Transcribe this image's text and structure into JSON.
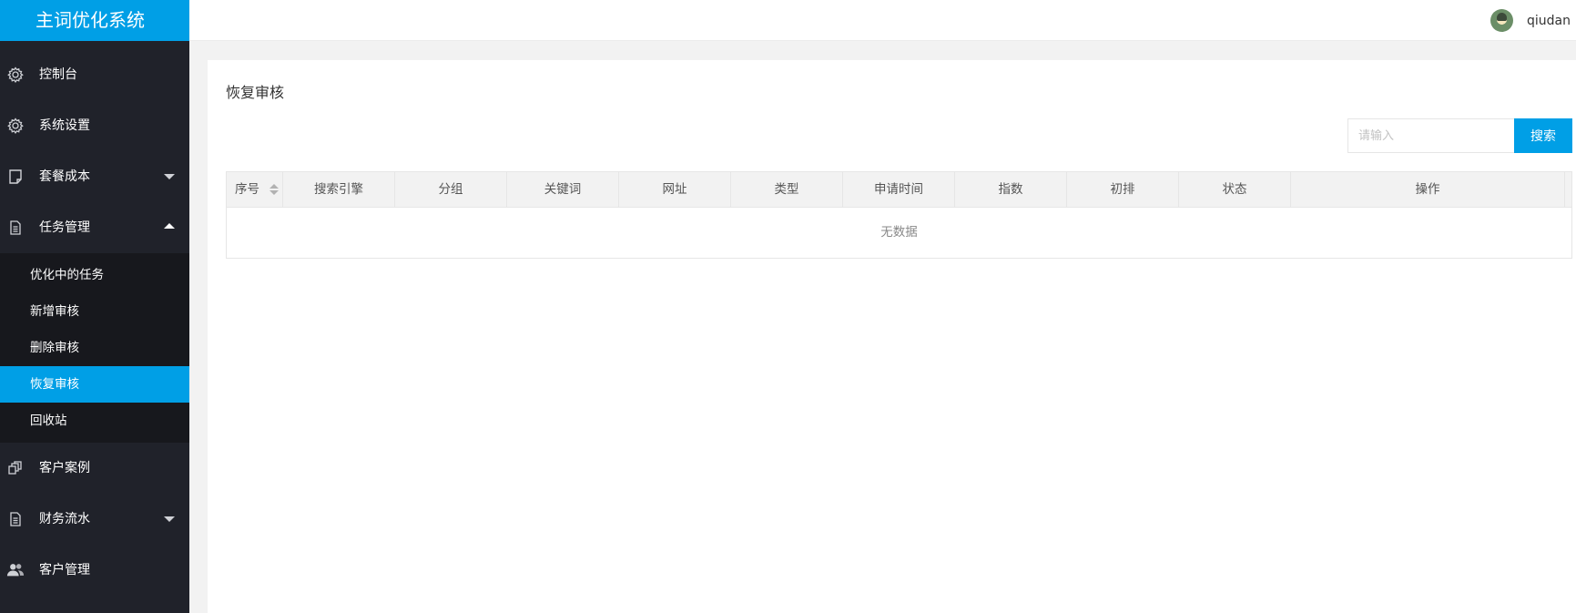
{
  "app": {
    "title": "主词优化系统"
  },
  "header": {
    "username": "qiudan"
  },
  "sidebar": {
    "items": [
      {
        "label": "控制台",
        "icon": "gear-icon"
      },
      {
        "label": "系统设置",
        "icon": "gear-icon"
      },
      {
        "label": "套餐成本",
        "icon": "note-icon",
        "arrow": "down"
      },
      {
        "label": "任务管理",
        "icon": "document-icon",
        "arrow": "up",
        "expanded": true
      },
      {
        "label": "客户案例",
        "icon": "cards-icon"
      },
      {
        "label": "财务流水",
        "icon": "document-icon",
        "arrow": "down"
      },
      {
        "label": "客户管理",
        "icon": "users-icon"
      }
    ],
    "submenu": [
      {
        "label": "优化中的任务"
      },
      {
        "label": "新增审核"
      },
      {
        "label": "删除审核"
      },
      {
        "label": "恢复审核",
        "active": true
      },
      {
        "label": "回收站"
      }
    ]
  },
  "main": {
    "title": "恢复审核",
    "search": {
      "placeholder": "请输入",
      "value": "",
      "button_label": "搜索"
    },
    "table": {
      "columns": [
        "序号",
        "搜索引擎",
        "分组",
        "关键词",
        "网址",
        "类型",
        "申请时间",
        "指数",
        "初排",
        "状态",
        "操作"
      ],
      "empty_text": "无数据"
    }
  },
  "colors": {
    "accent": "#009fe6",
    "sidebar_bg": "#20222a",
    "submenu_bg": "#17181d"
  }
}
